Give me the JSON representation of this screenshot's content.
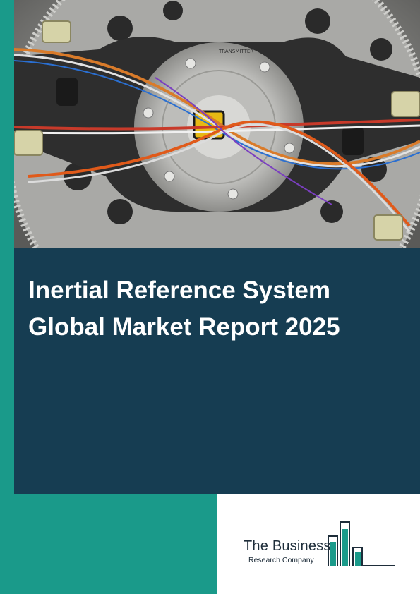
{
  "cover": {
    "title_line1": "Inertial Reference System",
    "title_line2": "Global Market Report 2025",
    "photo_caption_text": "TRANSMITTER"
  },
  "publisher": {
    "name": "The Business",
    "subtitle": "Research Company",
    "brand_color": "#1a9a8a",
    "ink_color": "#1e2d3a"
  },
  "colors": {
    "accent_teal": "#1a9a8a",
    "panel_navy": "#163d52"
  },
  "icons": [
    "bar-chart-logo-icon"
  ]
}
